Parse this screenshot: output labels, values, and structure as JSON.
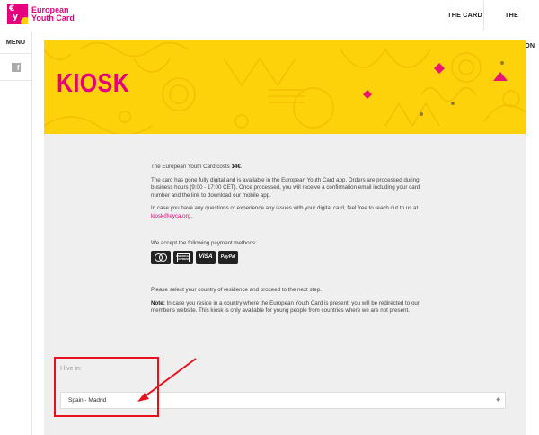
{
  "header": {
    "logo_line1": "European",
    "logo_line2": "Youth Card",
    "nav": [
      "THE CARD",
      "THE ASSOCIATION"
    ]
  },
  "sidebar": {
    "menu_label": "MENU",
    "social_icon": "facebook-icon"
  },
  "banner": {
    "title": "KIOSK",
    "bg_color": "#fdd20b",
    "title_color": "#e6007e"
  },
  "content": {
    "cost_prefix": "The European Youth Card costs ",
    "cost_value": "14€",
    "cost_suffix": ".",
    "digital_text": "The card has gone fully digital and is available in the European Youth Card app. Orders are processed during business hours (9:00 - 17:00 CET). Once processed, you will receive a confirmation email including your card number and the link to download our mobile app.",
    "contact_prefix": "In case you have any questions or experience any issues with your digital card, feel free to reach out to us at ",
    "contact_email": "kiosk@eyca.org",
    "contact_suffix": ".",
    "payments_label": "We accept the following payment methods:",
    "payment_methods": [
      "mastercard",
      "AMERICAN EXPRESS",
      "VISA",
      "PayPal"
    ],
    "select_country_text": "Please select your country of residence and proceed to the next step.",
    "note_label": "Note:",
    "note_text": " In case you reside in a country where the European Youth Card is present, you will be redirected to our member's website. This kiosk is only available for young people from countries where we are not present."
  },
  "form": {
    "live_in_label": "I live in:",
    "selected_value": "Spain - Madrid",
    "caret": "◆"
  },
  "annotation": {
    "color": "#e8101c"
  }
}
